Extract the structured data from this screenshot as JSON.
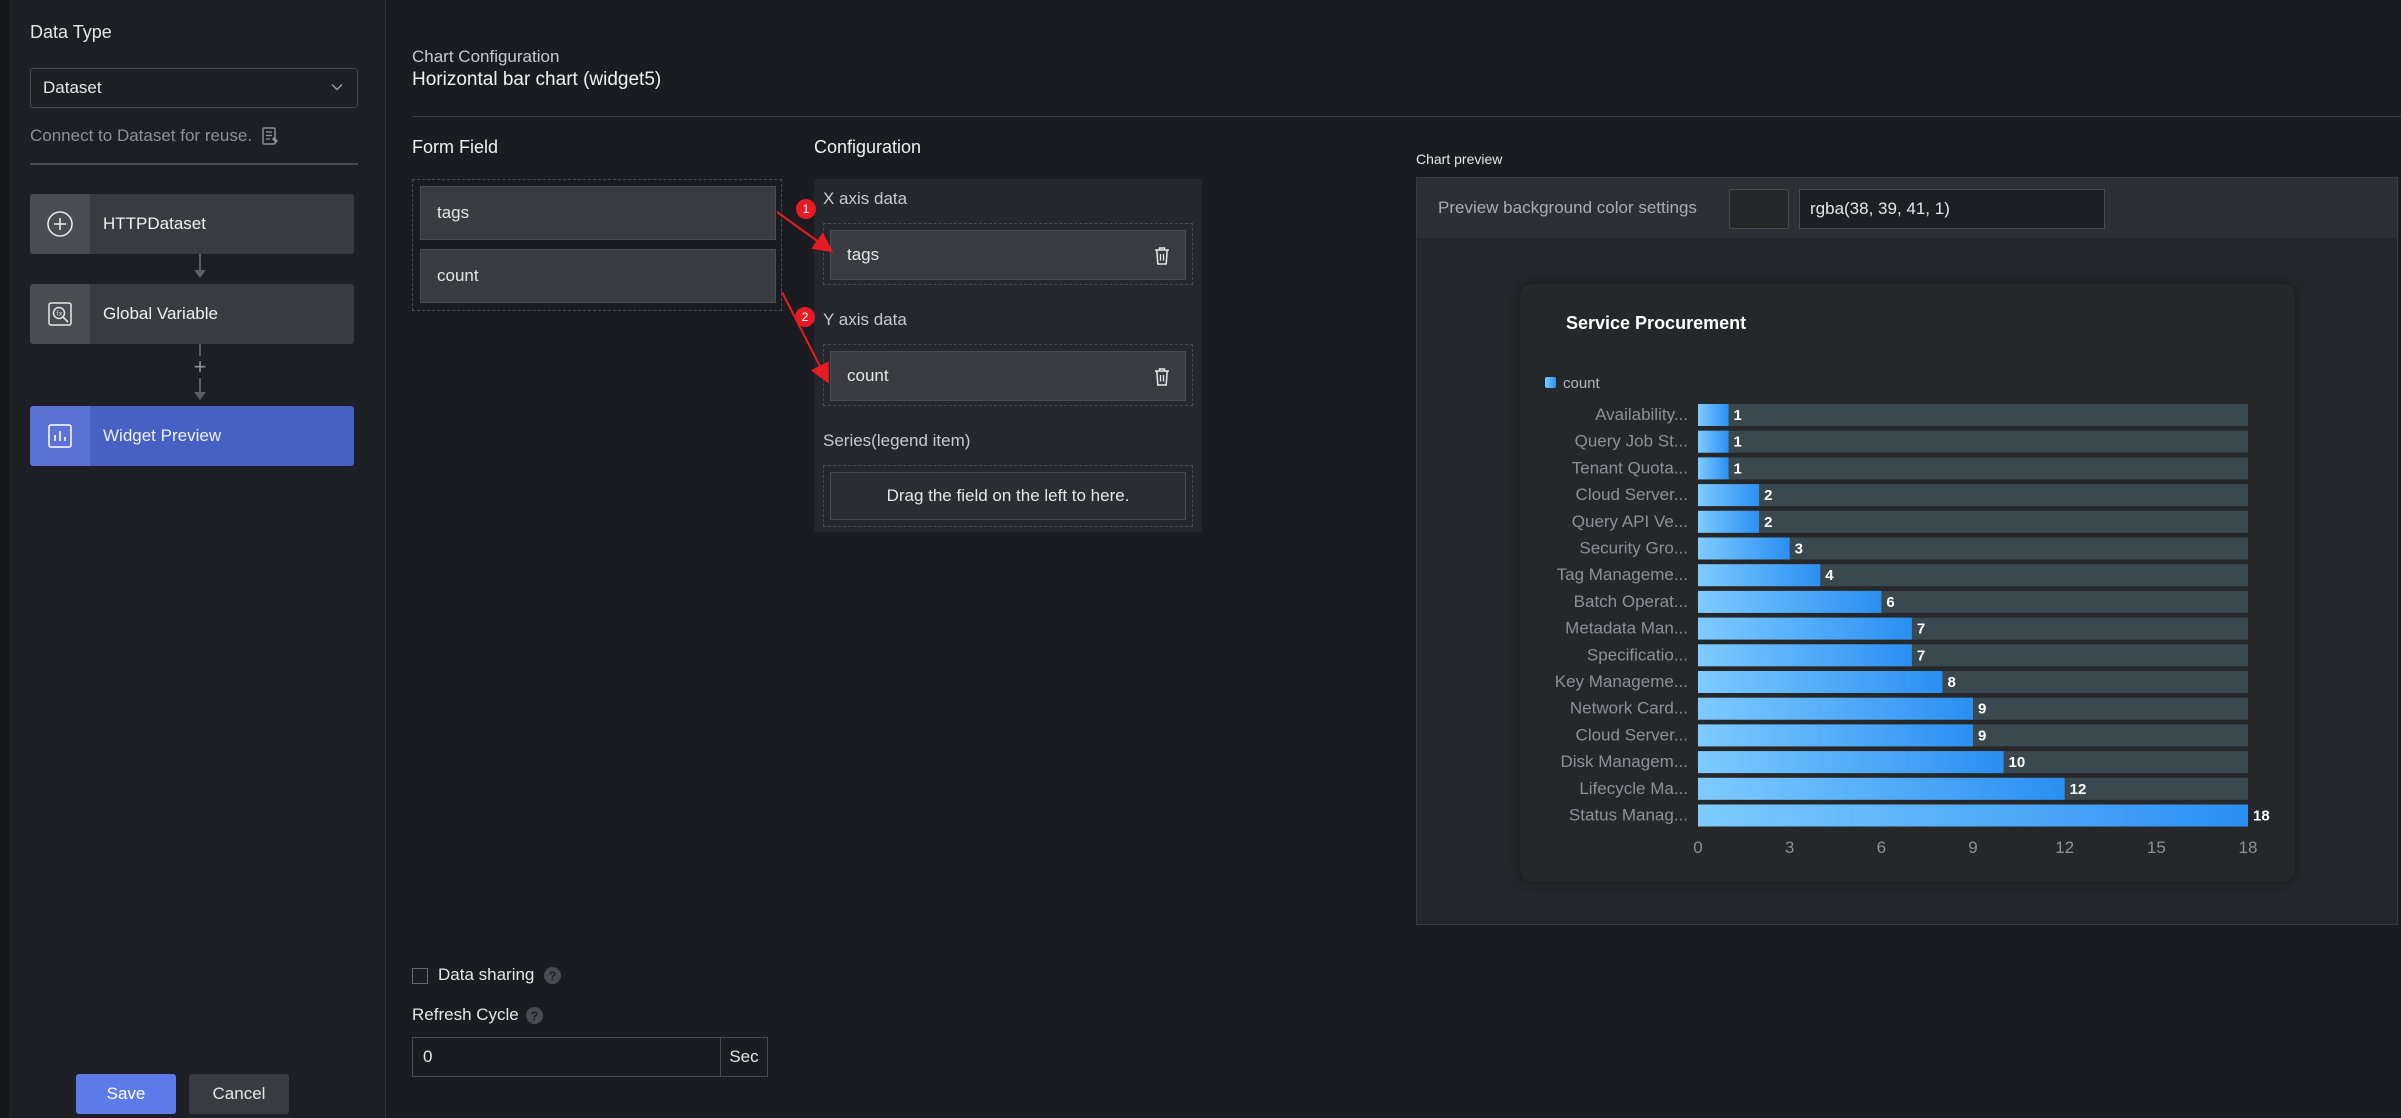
{
  "sidebar": {
    "title": "Data Type",
    "select_value": "Dataset",
    "connect_text": "Connect to Dataset for reuse.",
    "steps": [
      {
        "label": "HTTPDataset",
        "icon": "plus-circle-icon"
      },
      {
        "label": "Global Variable",
        "icon": "variable-icon"
      },
      {
        "label": "Widget Preview",
        "icon": "chart-icon"
      }
    ],
    "save_label": "Save",
    "cancel_label": "Cancel"
  },
  "config": {
    "label": "Chart Configuration",
    "title": "Horizontal bar chart (widget5)",
    "form_field_heading": "Form Field",
    "configuration_heading": "Configuration",
    "form_fields": [
      "tags",
      "count"
    ],
    "x_axis_label": "X axis data",
    "x_axis_field": "tags",
    "y_axis_label": "Y axis data",
    "y_axis_field": "count",
    "series_label": "Series(legend item)",
    "series_placeholder": "Drag the field on the left to here.",
    "badges": [
      "1",
      "2"
    ]
  },
  "preview": {
    "label": "Chart preview",
    "bg_label": "Preview background color settings",
    "bg_value": "rgba(38, 39, 41, 1)"
  },
  "bottom": {
    "data_sharing_label": "Data sharing",
    "refresh_label": "Refresh Cycle",
    "refresh_value": "0",
    "refresh_unit": "Sec"
  },
  "colors": {
    "accent": "#4660c4",
    "save_button": "#5c7ae8",
    "bar_light": "#7ecbff",
    "bar_dark": "#2a8ff2",
    "bar_track": "#3a4950",
    "badge": "#e51c23"
  },
  "chart_data": {
    "type": "bar",
    "orientation": "horizontal",
    "title": "Service Procurement",
    "legend": [
      "count"
    ],
    "legend_placement": "top-left",
    "categories": [
      "Availability...",
      "Query Job St...",
      "Tenant Quota...",
      "Cloud Server...",
      "Query API Ve...",
      "Security Gro...",
      "Tag Manageme...",
      "Batch Operat...",
      "Metadata Man...",
      "Specificatio...",
      "Key Manageme...",
      "Network Card...",
      "Cloud Server...",
      "Disk Managem...",
      "Lifecycle Ma...",
      "Status Manag..."
    ],
    "values": [
      1,
      1,
      1,
      2,
      2,
      3,
      4,
      6,
      7,
      7,
      8,
      9,
      9,
      10,
      12,
      18
    ],
    "xlim": [
      0,
      18
    ],
    "xticks": [
      0,
      3,
      6,
      9,
      12,
      15,
      18
    ],
    "grid": false
  }
}
